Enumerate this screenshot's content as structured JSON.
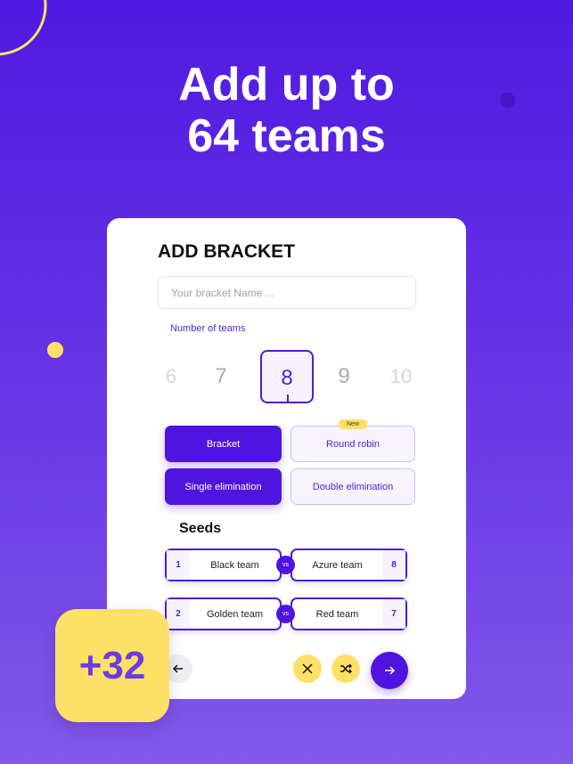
{
  "headline": {
    "line1": "Add up to",
    "line2": "64 teams"
  },
  "card": {
    "title": "ADD BRACKET",
    "name_placeholder": "Your bracket Name ...",
    "number_label": "Number of teams",
    "numbers": [
      "6",
      "7",
      "8",
      "9",
      "10"
    ],
    "selected_number": "8",
    "options": {
      "bracket": "Bracket",
      "round_robin": "Round robin",
      "new_badge": "New",
      "single": "Single elimination",
      "double": "Double elimination"
    },
    "seeds_title": "Seeds",
    "matches": [
      {
        "left_seed": "1",
        "left_team": "Black team",
        "vs": "vs",
        "right_team": "Azure team",
        "right_seed": "8"
      },
      {
        "left_seed": "2",
        "left_team": "Golden team",
        "vs": "vs",
        "right_team": "Red team",
        "right_seed": "7"
      }
    ],
    "icons": {
      "back": "arrow-left-icon",
      "clear": "close-icon",
      "shuffle": "shuffle-icon",
      "next": "arrow-right-icon"
    }
  },
  "badge": "+32",
  "colors": {
    "accent": "#4f14e0",
    "yellow": "#ffe066"
  }
}
